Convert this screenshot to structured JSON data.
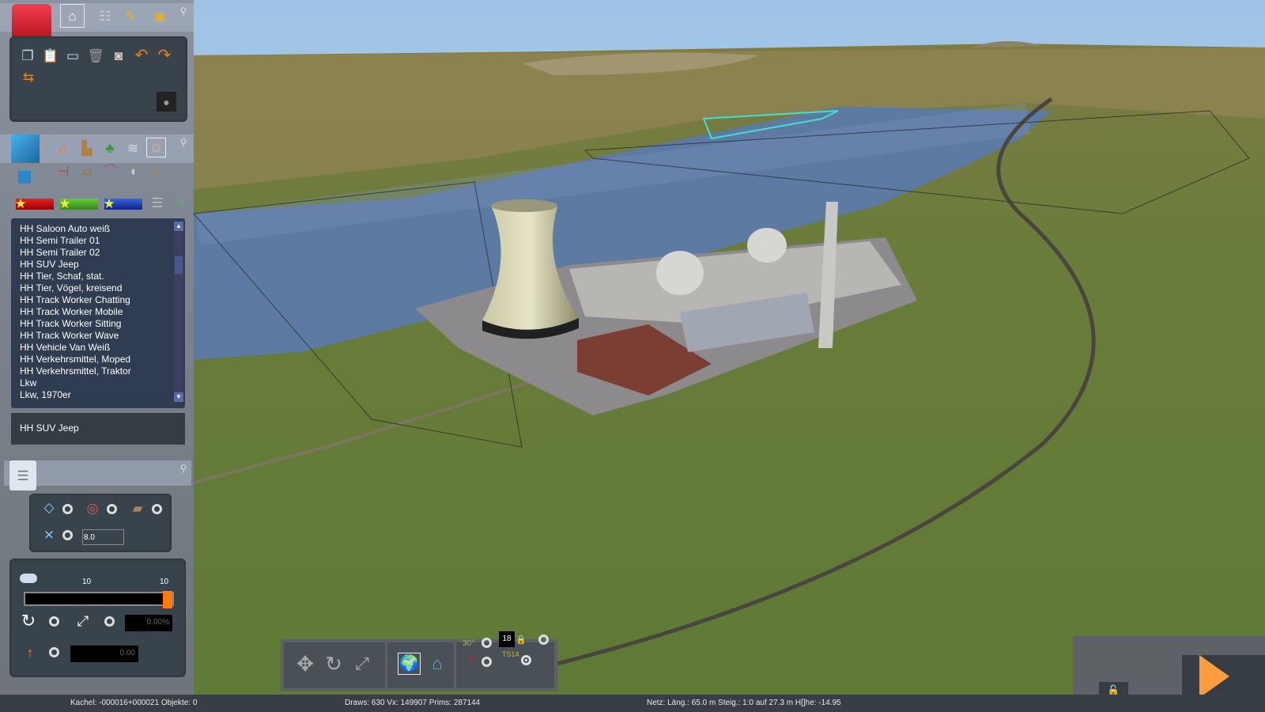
{
  "top_toolbar": {
    "icons": [
      "toolbox-icon",
      "home-icon",
      "track-icon",
      "brush-icon",
      "train-icon",
      "pin-icon"
    ]
  },
  "edit_toolbar": {
    "icons": [
      "copy-icon",
      "paste-icon",
      "monitor-icon",
      "trash-icon",
      "measure-icon",
      "undo-icon",
      "redo-icon",
      "settings-icon",
      "light-icon"
    ]
  },
  "category_toolbar": {
    "icons": [
      "cube-icon",
      "small-cube-icon",
      "house-icon",
      "industry-icon",
      "tree-icon",
      "landscape-icon",
      "person-icon",
      "signal-icon",
      "bench-icon",
      "bridge-icon",
      "speaker-icon",
      "sack-icon"
    ]
  },
  "favorites": [
    "favorites-red",
    "favorites-green",
    "favorites-blue"
  ],
  "object_list": {
    "items": [
      "HH Saloon Auto weiß",
      "HH Semi Trailer 01",
      "HH Semi Trailer 02",
      "HH SUV Jeep",
      "HH Tier, Schaf, stat.",
      "HH Tier, Vögel, kreisend",
      "HH Track Worker Chatting",
      "HH Track Worker Mobile",
      "HH Track Worker Sitting",
      "HH Track Worker Wave",
      "HH Vehicle Van Weiß",
      "HH Verkehrsmittel, Moped",
      "HH Verkehrsmittel, Traktor",
      "Lkw",
      "Lkw, 1970er"
    ],
    "selected": "HH SUV Jeep"
  },
  "placement": {
    "height_value": "8.0"
  },
  "transform": {
    "slider_min_label": "10",
    "slider_max_label": "10",
    "slider_fraction": 1.0,
    "scale_value": "0.00%",
    "height_offset": "0.00"
  },
  "bottom_toolbar": {
    "grid_value": "18",
    "ts_label": "TS14",
    "angle_label": "30°"
  },
  "status": {
    "tile": "Kachel: -000016+000021  Objekte: 0",
    "draws": "Draws: 630 Vx: 149907 Prims: 287144",
    "net": "Netz:  Läng.:   65.0 m Steig.: 1:0 auf 27.3 m H[]he: -14.95"
  },
  "colors": {
    "accent": "#ff7a00",
    "panel": "#39434b",
    "status": "#373f44"
  }
}
